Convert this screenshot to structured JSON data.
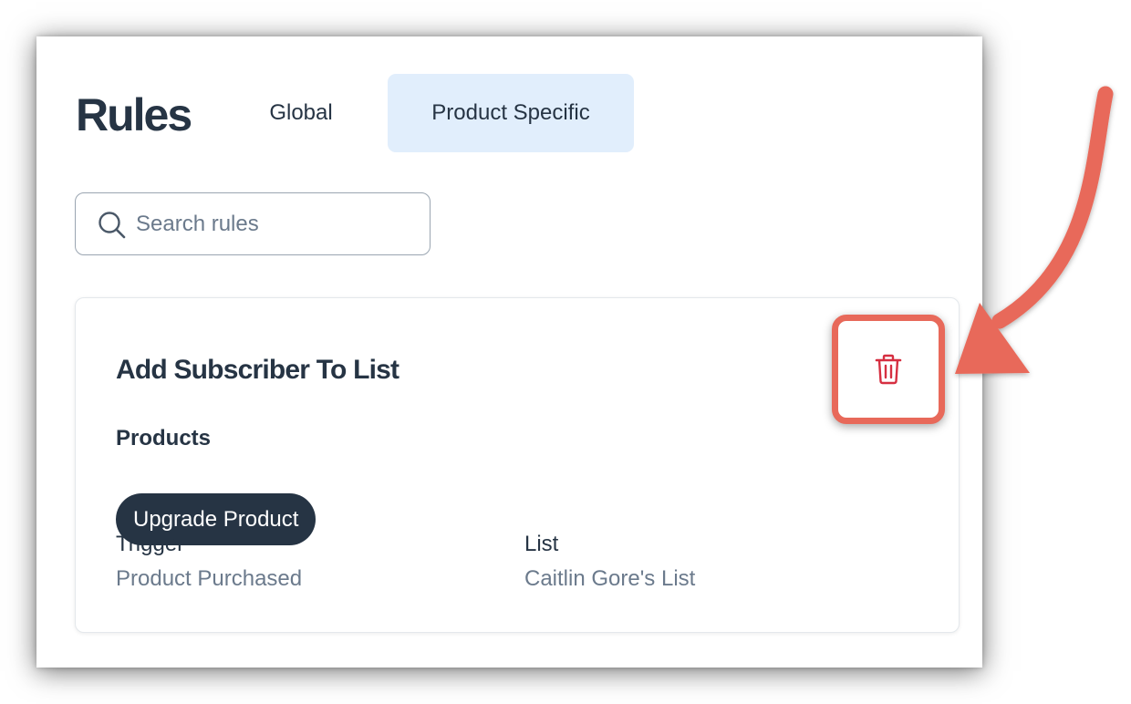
{
  "header": {
    "title": "Rules"
  },
  "tabs": [
    {
      "label": "Global",
      "active": false
    },
    {
      "label": "Product Specific",
      "active": true
    }
  ],
  "search": {
    "value": "",
    "placeholder": "Search rules",
    "icon": "search-icon"
  },
  "rule": {
    "title": "Add Subscriber To List",
    "delete_icon": "trash-icon",
    "products_label": "Products",
    "products": [
      "Upgrade Product"
    ],
    "trigger_label": "Trigger",
    "trigger_value": "Product Purchased",
    "list_label": "List",
    "list_value": "Caitlin Gore's List"
  },
  "colors": {
    "text_primary": "#263444",
    "text_muted": "#6b7a8c",
    "active_tab_bg": "#e1eefc",
    "pill_bg": "#263444",
    "delete_icon": "#d62f41",
    "annotation": "#e8695a"
  }
}
